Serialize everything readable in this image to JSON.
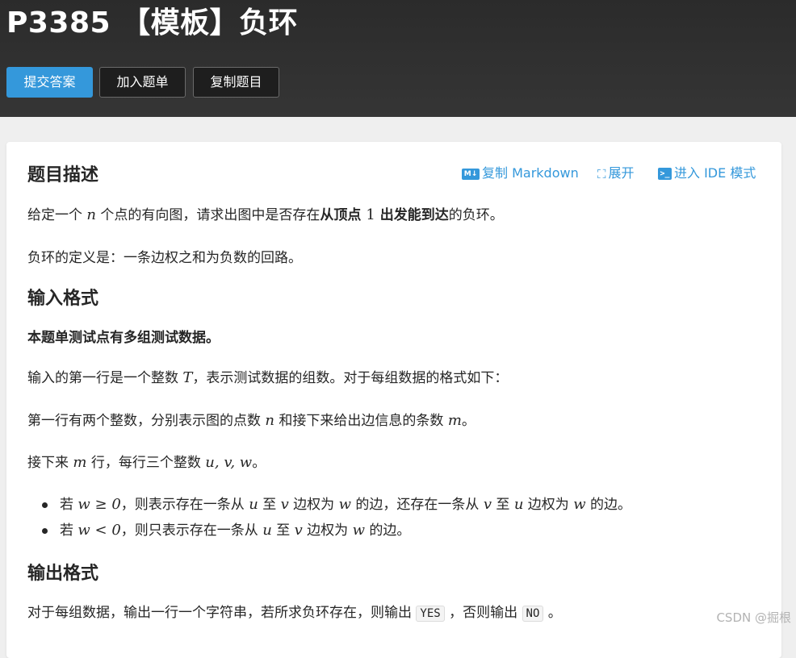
{
  "header": {
    "title": "P3385 【模板】负环",
    "buttons": {
      "submit": "提交答案",
      "add_to_list": "加入题单",
      "copy_problem": "复制题目"
    }
  },
  "actions": {
    "copy_markdown": "复制 Markdown",
    "copy_markdown_icon_text": "M↓",
    "expand": "展开",
    "expand_icon_text": "⛶",
    "ide_mode": "进入 IDE 模式",
    "ide_icon_text": ">_"
  },
  "description": {
    "heading": "题目描述",
    "p1": {
      "t1": "给定一个 ",
      "m1": "n",
      "t2": " 个点的有向图，请求出图中是否存在",
      "b1": "从顶点 ",
      "m2": "1",
      "b2": " 出发能到达",
      "t3": "的负环。"
    },
    "p2": "负环的定义是：一条边权之和为负数的回路。"
  },
  "input_format": {
    "heading": "输入格式",
    "p_bold": "本题单测试点有多组测试数据。",
    "p1": {
      "t1": "输入的第一行是一个整数 ",
      "m1": "T",
      "t2": "，表示测试数据的组数。对于每组数据的格式如下："
    },
    "p2": {
      "t1": "第一行有两个整数，分别表示图的点数 ",
      "m1": "n",
      "t2": " 和接下来给出边信息的条数 ",
      "m2": "m",
      "t3": "。"
    },
    "p3": {
      "t1": "接下来 ",
      "m1": "m",
      "t2": " 行，每行三个整数 ",
      "m2": "u, v, w",
      "t3": "。"
    },
    "bullets": [
      {
        "t1": "若 ",
        "m1": "w ≥ 0",
        "t2": "，则表示存在一条从 ",
        "m2": "u",
        "t3": " 至 ",
        "m3": "v",
        "t4": " 边权为 ",
        "m4": "w",
        "t5": " 的边，还存在一条从 ",
        "m5": "v",
        "t6": " 至 ",
        "m6": "u",
        "t7": " 边权为 ",
        "m7": "w",
        "t8": " 的边。"
      },
      {
        "t1": "若 ",
        "m1": "w < 0",
        "t2": "，则只表示存在一条从 ",
        "m2": "u",
        "t3": " 至 ",
        "m3": "v",
        "t4": " 边权为 ",
        "m4": "w",
        "t5": " 的边。"
      }
    ]
  },
  "output_format": {
    "heading": "输出格式",
    "p1": {
      "t1": "对于每组数据，输出一行一个字符串，若所求负环存在，则输出 ",
      "c1": "YES",
      "t2": " ，否则输出 ",
      "c2": "NO",
      "t3": " 。"
    }
  },
  "watermark": "CSDN @掘根",
  "colors": {
    "header_bg": "#2b2b2b",
    "primary": "#3498db",
    "page_bg": "#efefef",
    "card_bg": "#ffffff"
  }
}
